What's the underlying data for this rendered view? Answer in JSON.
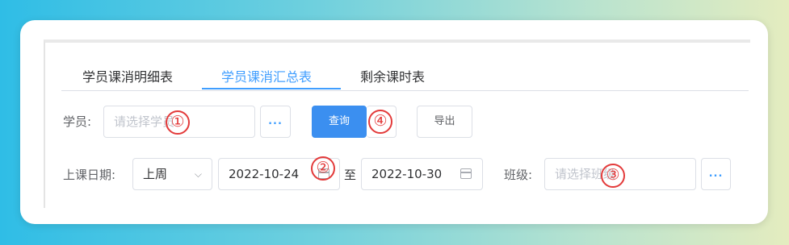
{
  "tabs": [
    {
      "label": "学员课消明细表",
      "active": false
    },
    {
      "label": "学员课消汇总表",
      "active": true
    },
    {
      "label": "剩余课时表",
      "active": false
    }
  ],
  "student": {
    "label": "学员:",
    "placeholder": "请选择学员",
    "more": "..."
  },
  "actions": {
    "query": "查询",
    "export": "导出"
  },
  "date_filter": {
    "label": "上课日期:",
    "preset": "上周",
    "start": "2022-10-24",
    "separator": "至",
    "end": "2022-10-30"
  },
  "class_filter": {
    "label": "班级:",
    "placeholder": "请选择班级",
    "more": "..."
  },
  "annotations": [
    "①",
    "②",
    "③",
    "④"
  ],
  "colors": {
    "accent": "#409eff",
    "primary_button": "#3b8ff0",
    "annotation": "#e33a3a"
  }
}
